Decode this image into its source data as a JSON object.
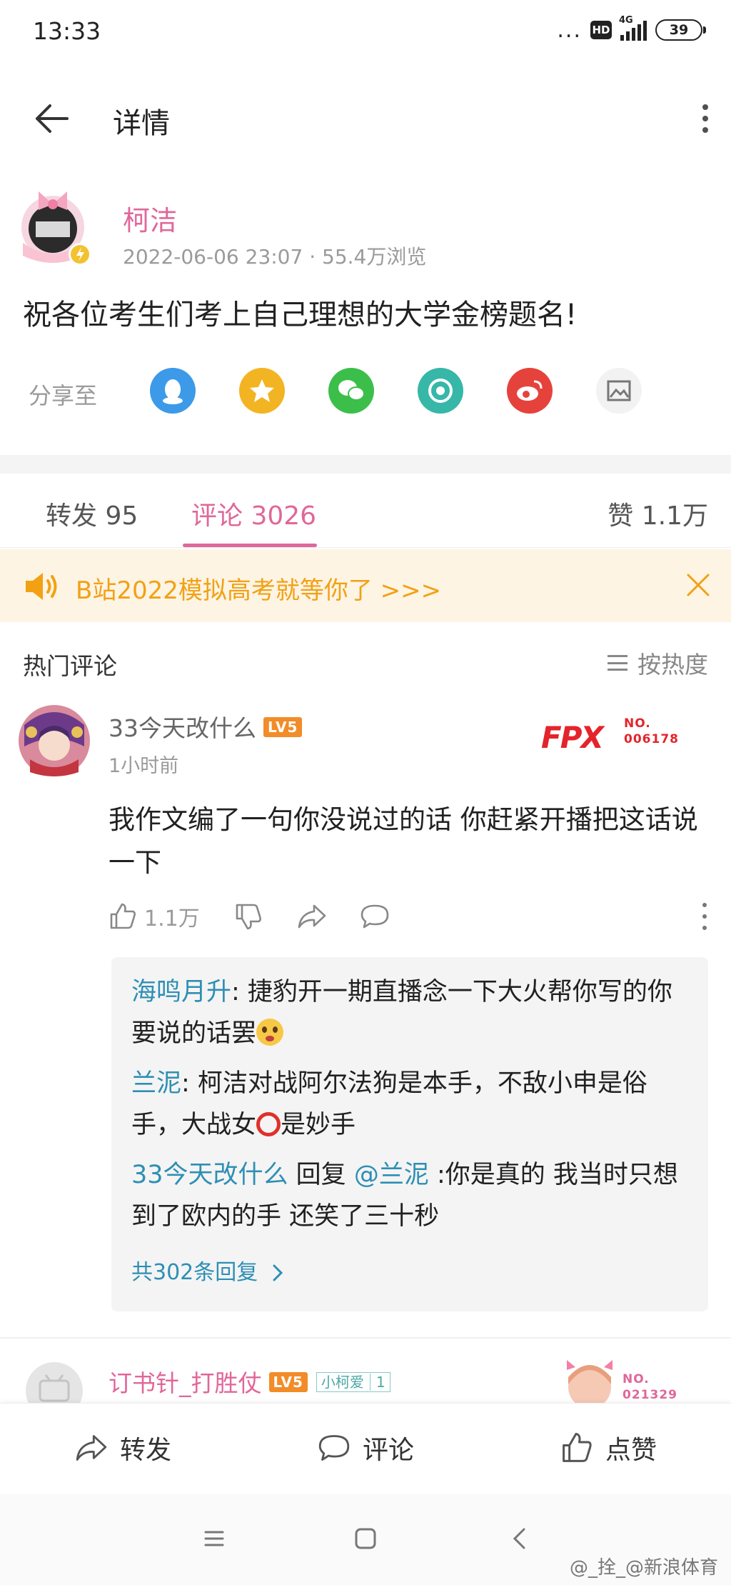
{
  "status_bar": {
    "time": "13:33",
    "dots": "...",
    "hd": "HD",
    "network": "4G",
    "battery": "39"
  },
  "header": {
    "title": "详情"
  },
  "post": {
    "author": "柯洁",
    "meta": "2022-06-06 23:07 · 55.4万浏览",
    "text": "祝各位考生们考上自己理想的大学金榜题名!"
  },
  "share": {
    "label": "分享至",
    "targets": [
      {
        "icon": "qq-icon",
        "color": "#3c9ae8"
      },
      {
        "icon": "qzone-icon",
        "color": "#f2b422"
      },
      {
        "icon": "wechat-icon",
        "color": "#3cbf4a"
      },
      {
        "icon": "moments-icon",
        "color": "#36b7a8"
      },
      {
        "icon": "weibo-icon",
        "color": "#e6423c"
      },
      {
        "icon": "image-icon",
        "color": "#f2f2f2"
      }
    ]
  },
  "tabs": {
    "forward": "转发 95",
    "comments": "评论 3026",
    "likes": "赞 1.1万"
  },
  "notice": {
    "text": "B站2022模拟高考就等你了 >>>"
  },
  "comments_header": {
    "title": "热门评论",
    "sort_label": "按热度"
  },
  "comment1": {
    "user": "33今天改什么",
    "level": "LV5",
    "time": "1小时前",
    "card_logo": "FPX",
    "card_no_label": "NO.",
    "card_no": "006178",
    "text": "我作文编了一句你没说过的话 你赶紧开播把这话说一下",
    "like_count": "1.1万",
    "replies": [
      {
        "user": "海鸣月升",
        "text": ": 捷豹开一期直播念一下大火帮你写的你要说的话罢"
      },
      {
        "user": "兰泥",
        "text_a": ": 柯洁对战阿尔法狗是本手，不敌小申是俗手，大战女",
        "text_b": "是妙手"
      },
      {
        "user": "33今天改什么",
        "reply_word": " 回复 ",
        "mention": "@兰泥",
        "text": " :你是真的 我当时只想到了欧内的手 还笑了三十秒"
      }
    ],
    "more_replies": "共302条回复"
  },
  "comment2": {
    "user": "订书针_打胜仗",
    "level": "LV5",
    "fan_badge": "小柯爱",
    "fan_level": "1",
    "card_no_label": "NO.",
    "card_no": "021329"
  },
  "bottom_bar": {
    "forward": "转发",
    "comment": "评论",
    "like": "点赞"
  },
  "watermark": "@_拴_@新浪体育"
}
